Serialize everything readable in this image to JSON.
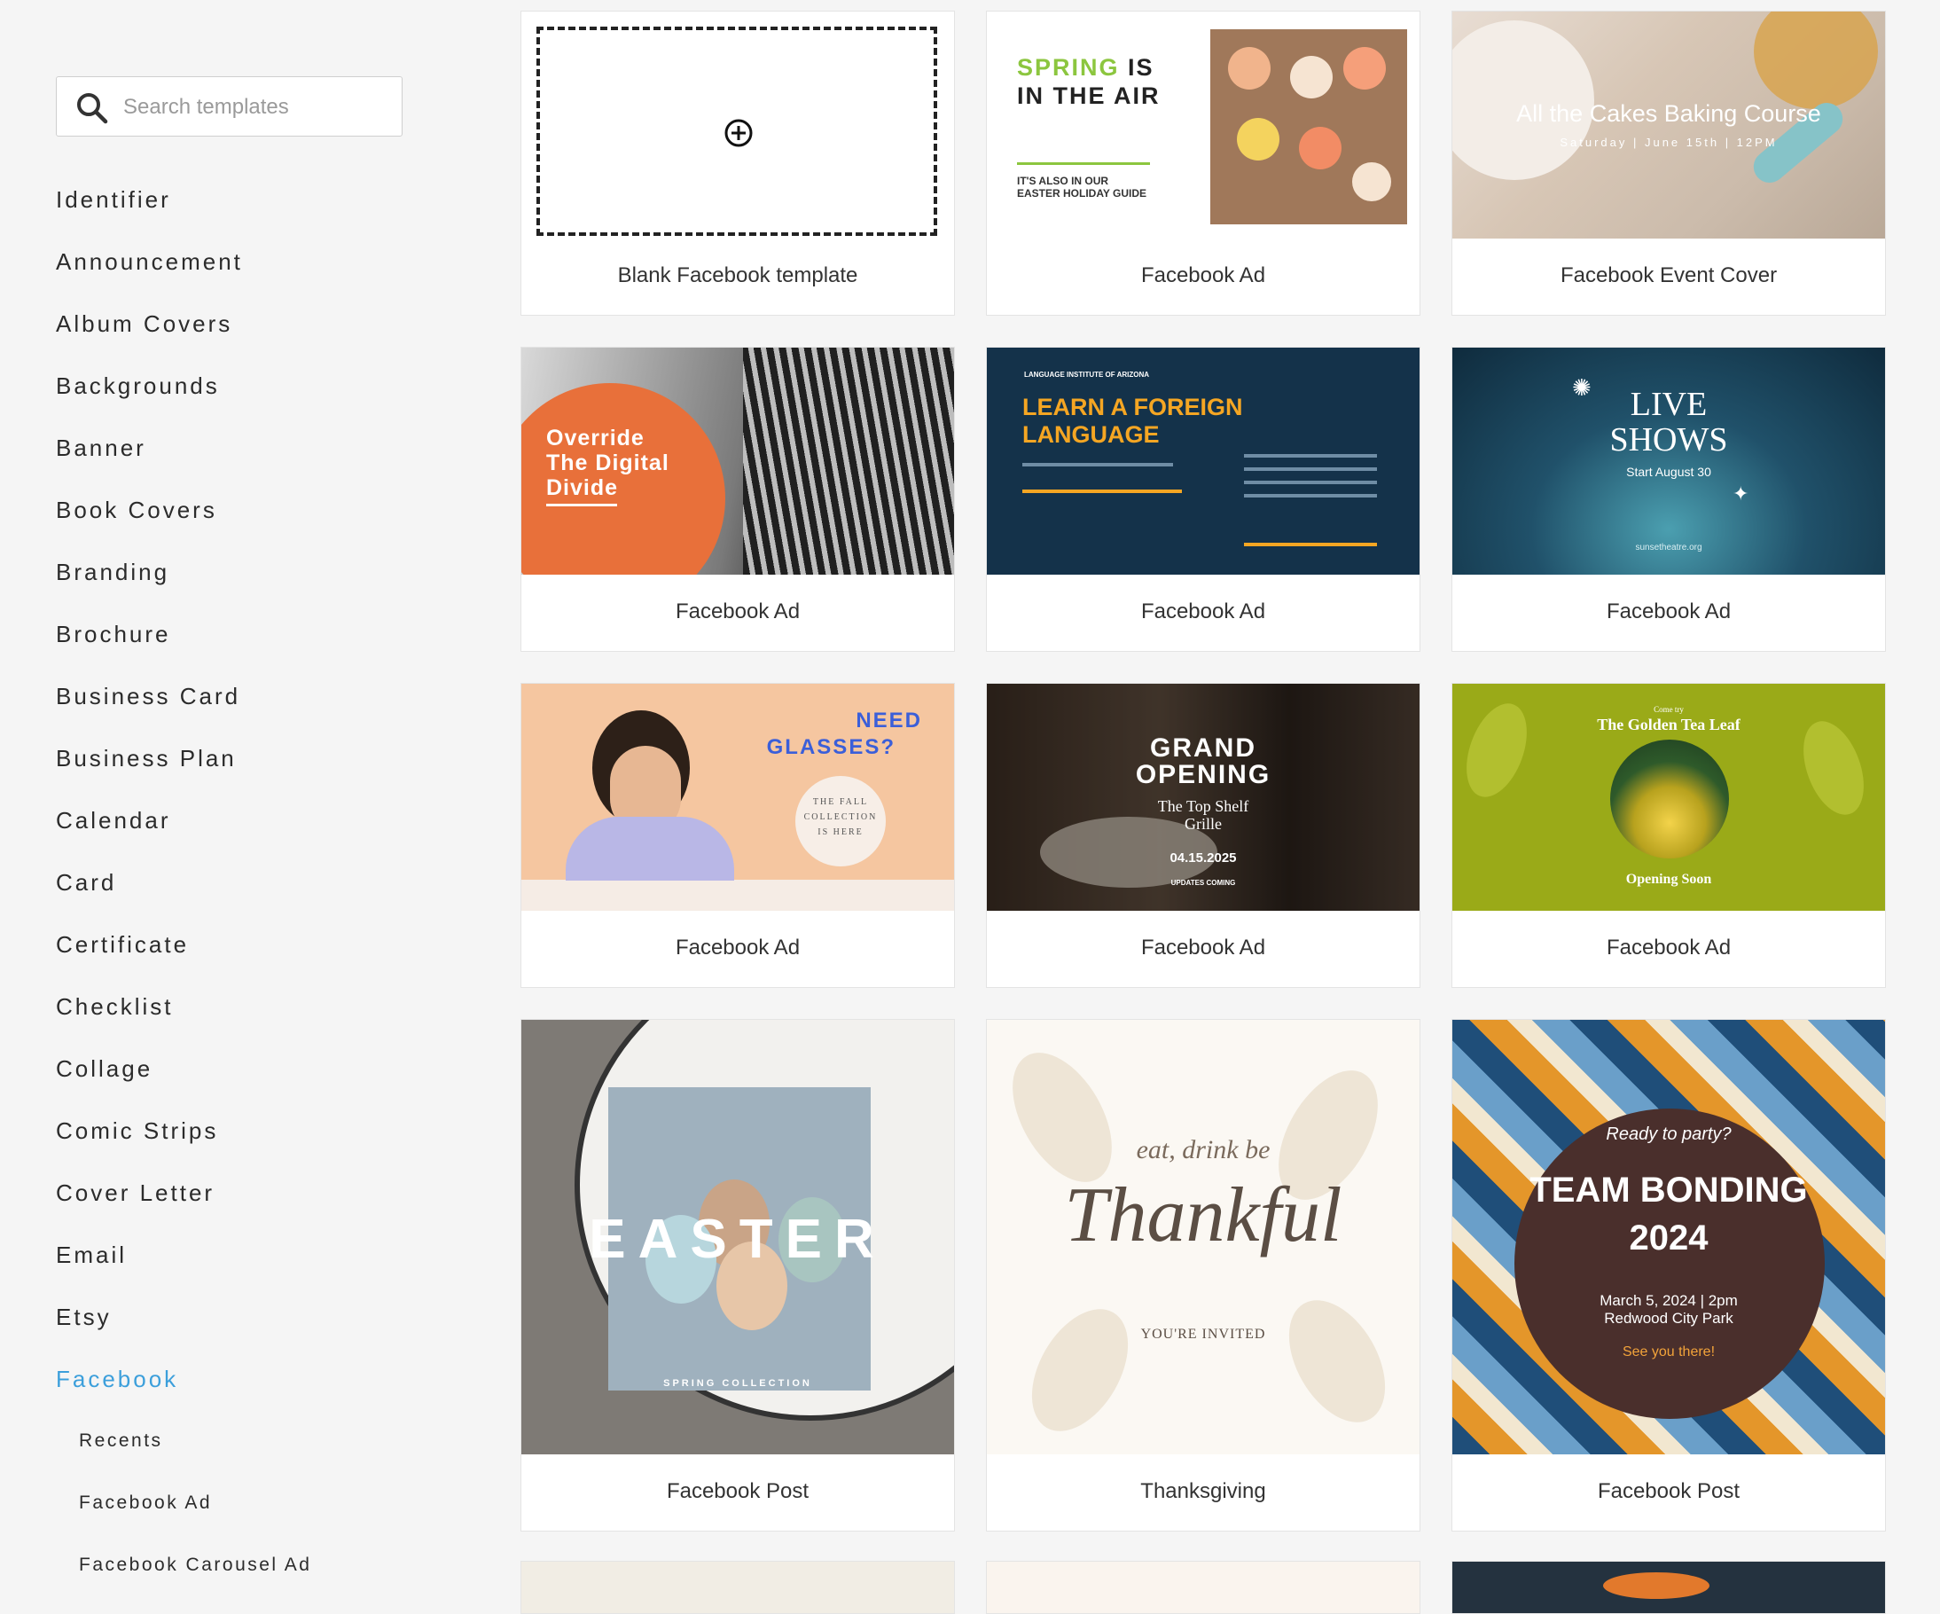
{
  "search": {
    "placeholder": "Search templates"
  },
  "categories": [
    "Identifier",
    "Announcement",
    "Album Covers",
    "Backgrounds",
    "Banner",
    "Book Covers",
    "Branding",
    "Brochure",
    "Business Card",
    "Business Plan",
    "Calendar",
    "Card",
    "Certificate",
    "Checklist",
    "Collage",
    "Comic Strips",
    "Cover Letter",
    "Email",
    "Etsy",
    "Facebook"
  ],
  "active_category": "Facebook",
  "subcategories": [
    "Recents",
    "Facebook Ad",
    "Facebook Carousel Ad"
  ],
  "accent_color": "#3c9fdb",
  "cards": [
    {
      "caption": "Blank Facebook template",
      "icon": "plus-circle-icon"
    },
    {
      "caption": "Facebook Ad",
      "t1": "SPRING",
      "t2": "IS",
      "t3": "IN THE AIR",
      "t4": "IT'S ALSO IN OUR",
      "t5": "EASTER HOLIDAY GUIDE"
    },
    {
      "caption": "Facebook Event Cover",
      "t1": "All the Cakes Baking Course",
      "t2": "Saturday | June 15th | 12PM"
    },
    {
      "caption": "Facebook Ad",
      "t1": "Override",
      "t2": "The Digital",
      "t3": "Divide"
    },
    {
      "caption": "Facebook Ad",
      "t1": "LANGUAGE INSTITUTE OF ARIZONA",
      "t2": "LEARN A FOREIGN",
      "t3": "LANGUAGE"
    },
    {
      "caption": "Facebook Ad",
      "t1": "LIVE",
      "t2": "SHOWS",
      "t3": "Start August 30",
      "t4": "sunsetheatre.org"
    },
    {
      "caption": "Facebook Ad",
      "t1": "NEED",
      "t2": "GLASSES?",
      "t3": "THE FALL",
      "t4": "COLLECTION",
      "t5": "IS HERE"
    },
    {
      "caption": "Facebook Ad",
      "t1": "GRAND",
      "t2": "OPENING",
      "t3": "The Top Shelf",
      "t4": "Grille",
      "t5": "04.15.2025",
      "t6": "UPDATES COMING"
    },
    {
      "caption": "Facebook Ad",
      "t1": "Come try",
      "t2": "The Golden Tea Leaf",
      "t3": "Opening Soon"
    },
    {
      "caption": "Facebook Post",
      "t1": "EASTER",
      "t2": "SPRING COLLECTION"
    },
    {
      "caption": "Thanksgiving",
      "t1": "eat, drink be",
      "t2": "Thankful",
      "t3": "YOU'RE INVITED"
    },
    {
      "caption": "Facebook Post",
      "t1": "Ready to party?",
      "t2": "TEAM BONDING",
      "t3": "2024",
      "t4": "March 5, 2024 | 2pm",
      "t5": "Redwood City Park",
      "t6": "See you there!"
    }
  ]
}
